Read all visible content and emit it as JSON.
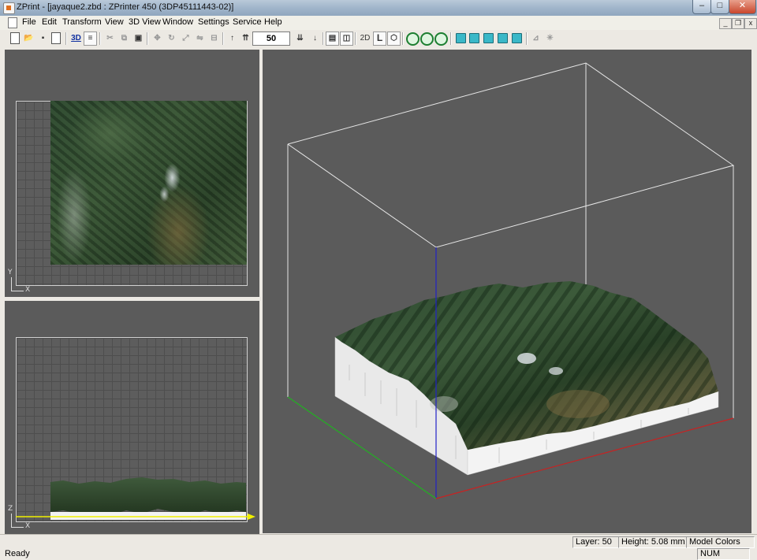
{
  "window": {
    "title": "ZPrint - [jayaque2.zbd : ZPrinter 450 (3DP45111443-02)]"
  },
  "menu": [
    "File",
    "Edit",
    "Transform",
    "View",
    "3D View",
    "Window",
    "Settings",
    "Service",
    "Help"
  ],
  "toolbar": {
    "layer_value": "50",
    "label_2d": "2D",
    "label_l": "L",
    "label_3d": "3D"
  },
  "views": {
    "top": {
      "axis_y": "Y",
      "axis_x": "X"
    },
    "front": {
      "axis_z": "Z",
      "axis_x": "X"
    }
  },
  "status": {
    "ready": "Ready",
    "layer": "Layer: 50",
    "height": "Height: 5.08 mm",
    "mode": "Model Colors",
    "num": "NUM"
  },
  "colors": {
    "axis_x": "#c02020",
    "axis_y": "#20a020",
    "axis_z": "#2020c0",
    "slice": "#f0f000"
  }
}
